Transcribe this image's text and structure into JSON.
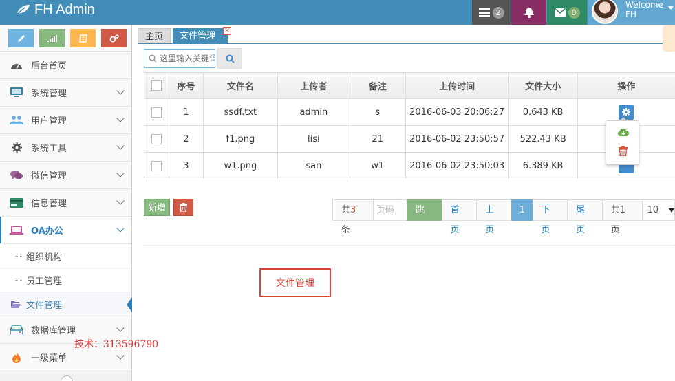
{
  "brand": {
    "title": "FH Admin"
  },
  "navbar": {
    "tasks_badge": "2",
    "messages_badge": "0",
    "welcome": "Welcome",
    "username": "FH"
  },
  "sidebar": {
    "items": [
      {
        "label": "后台首页",
        "icon": "dashboard-icon"
      },
      {
        "label": "系统管理",
        "icon": "desktop-icon"
      },
      {
        "label": "用户管理",
        "icon": "users-icon"
      },
      {
        "label": "系统工具",
        "icon": "gear-icon"
      },
      {
        "label": "微信管理",
        "icon": "comments-icon"
      },
      {
        "label": "信息管理",
        "icon": "credit-card-icon"
      },
      {
        "label": "OA办公",
        "icon": "laptop-icon"
      }
    ],
    "sub_items": [
      {
        "label": "组织机构"
      },
      {
        "label": "员工管理"
      },
      {
        "label": "文件管理"
      }
    ],
    "after_items": [
      {
        "label": "数据库管理",
        "icon": "hdd-icon"
      },
      {
        "label": "一级菜单",
        "icon": "fire-icon"
      }
    ],
    "watermark": "技术：313596790"
  },
  "tabs": {
    "home": "主页",
    "active": "文件管理",
    "close": "×"
  },
  "search": {
    "placeholder": "这里输入关键词"
  },
  "table": {
    "headers": [
      "序号",
      "文件名",
      "上传者",
      "备注",
      "上传时间",
      "文件大小",
      "操作"
    ],
    "rows": [
      [
        "1",
        "ssdf.txt",
        "admin",
        "s",
        "2016-06-03 20:06:27",
        "0.643 KB"
      ],
      [
        "2",
        "f1.png",
        "lisi",
        "21",
        "2016-06-02 23:50:57",
        "522.43 KB"
      ],
      [
        "3",
        "w1.png",
        "san",
        "w1",
        "2016-06-02 23:50:03",
        "6.389 KB"
      ]
    ]
  },
  "actions": {
    "add": "新增"
  },
  "pager": {
    "total_prefix": "共",
    "total_num": "3",
    "total_suffix": "条",
    "page_placeholder": "页码",
    "jump": "跳转",
    "first": "首页",
    "prev": "上页",
    "current": "1",
    "next": "下页",
    "last": "尾页",
    "pages": "共1页",
    "page_size": "10"
  },
  "note": "文件管理",
  "colors": {
    "navbar": "#438eb9",
    "accent": "#2b7dbc",
    "green": "#87b87f",
    "red": "#d15b47",
    "note_border": "#d9453a"
  }
}
